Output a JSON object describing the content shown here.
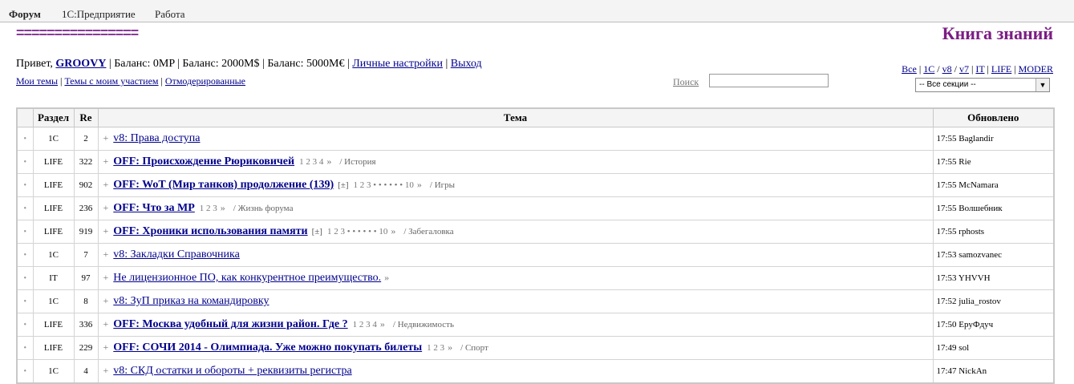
{
  "topnav": {
    "items": [
      "Форум",
      "1С:Предприятие",
      "Работа"
    ]
  },
  "header": {
    "decor": "================",
    "title": "Книга знаний"
  },
  "user": {
    "greeting": "Привет,",
    "name": "GROOVY",
    "balance1": "| Баланс: 0MP |",
    "balance2": "Баланс: 2000M$ |",
    "balance3": "Баланс: 5000M€ |",
    "settings": "Личные настройки",
    "sep": "|",
    "logout": "Выход"
  },
  "sublinks": {
    "my_topics": "Мои темы",
    "with_me": "Темы с моим участием",
    "moderated": "Отмодерированные"
  },
  "search": {
    "label": "Поиск",
    "value": ""
  },
  "sections": {
    "links": [
      "Все",
      "1С",
      "v8",
      "v7",
      "IT",
      "LIFE",
      "MODER"
    ],
    "select_value": "-- Все секции --"
  },
  "table": {
    "headers": {
      "section": "Раздел",
      "re": "Re",
      "topic": "Тема",
      "updated": "Обновлено"
    },
    "rows": [
      {
        "section": "1C",
        "re": "2",
        "title": "v8: Права доступа",
        "bold": false,
        "expand": "",
        "pages": "",
        "more": "",
        "category": "",
        "updated": "17:55 Baglandir"
      },
      {
        "section": "LIFE",
        "re": "322",
        "title": "OFF: Происхождение Рюриковичей",
        "bold": true,
        "expand": "",
        "pages": "1 2 3 4",
        "more": "»",
        "category": "/ История",
        "updated": "17:55 Rie"
      },
      {
        "section": "LIFE",
        "re": "902",
        "title": "OFF: WoT (Мир танков) продолжение (139)",
        "bold": true,
        "expand": "[±]",
        "pages": "1 2 3 • • • • • • 10",
        "more": "»",
        "category": "/ Игры",
        "updated": "17:55 McNamara"
      },
      {
        "section": "LIFE",
        "re": "236",
        "title": "OFF: Что за МР",
        "bold": true,
        "expand": "",
        "pages": "1 2 3",
        "more": "»",
        "category": "/ Жизнь форума",
        "updated": "17:55 Волшебник"
      },
      {
        "section": "LIFE",
        "re": "919",
        "title": "OFF: Хроники использования памяти",
        "bold": true,
        "expand": "[±]",
        "pages": "1 2 3 • • • • • • 10",
        "more": "»",
        "category": "/ Забегаловка",
        "updated": "17:55 rphosts"
      },
      {
        "section": "1C",
        "re": "7",
        "title": "v8: Закладки Справочника",
        "bold": false,
        "expand": "",
        "pages": "",
        "more": "",
        "category": "",
        "updated": "17:53 samozvanec"
      },
      {
        "section": "IT",
        "re": "97",
        "title": "Не лицензионное ПО, как конкурентное преимущество.",
        "bold": false,
        "expand": "",
        "pages": "",
        "more": "»",
        "category": "",
        "updated": "17:53 YHVVH"
      },
      {
        "section": "1C",
        "re": "8",
        "title": "v8: ЗуП приказ на командировку",
        "bold": false,
        "expand": "",
        "pages": "",
        "more": "",
        "category": "",
        "updated": "17:52 julia_rostov"
      },
      {
        "section": "LIFE",
        "re": "336",
        "title": "OFF: Москва удобный для жизни район. Где ?",
        "bold": true,
        "expand": "",
        "pages": "1 2 3 4",
        "more": "»",
        "category": "/ Недвижимость",
        "updated": "17:50 ЕруФдуч"
      },
      {
        "section": "LIFE",
        "re": "229",
        "title": "OFF: СОЧИ 2014 - Олимпиада. Уже можно покупать билеты",
        "bold": true,
        "expand": "",
        "pages": "1 2 3",
        "more": "»",
        "category": "/ Спорт",
        "updated": "17:49 sol"
      },
      {
        "section": "1C",
        "re": "4",
        "title": "v8: СКД остатки и обороты + реквизиты регистра",
        "bold": false,
        "expand": "",
        "pages": "",
        "more": "",
        "category": "",
        "updated": "17:47 NickAn"
      }
    ]
  }
}
